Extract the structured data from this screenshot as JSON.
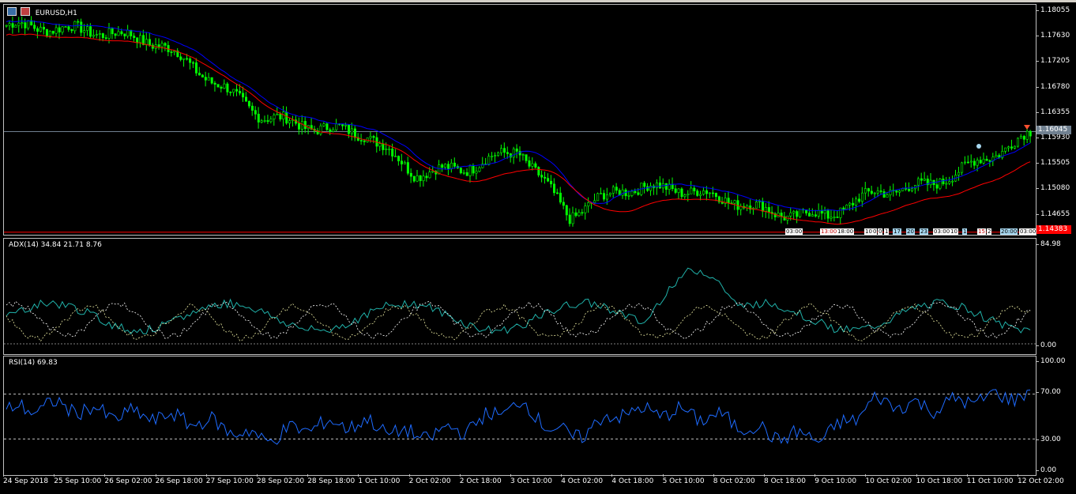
{
  "main": {
    "symbol_label": "EURUSD,H1",
    "price_ticks": [
      "1.18055",
      "1.17630",
      "1.17205",
      "1.16780",
      "1.16355",
      "1.15930",
      "1.15505",
      "1.15080",
      "1.14655"
    ],
    "current_price": "1.16045",
    "stop_level": "1.14383",
    "colors": {
      "candle": "#00ff00",
      "ma_fast": "#0000ff",
      "ma_slow": "#ff0000",
      "grid_line": "#708090",
      "stop_line": "#ff0000"
    },
    "trade_labels": [
      "03:00",
      "13:00",
      "18:00",
      "10",
      "0",
      "0",
      "1",
      "17",
      "20",
      "23",
      "03:00",
      "10",
      "1",
      "15",
      "2",
      "20:00",
      "03:00"
    ]
  },
  "adx": {
    "label": "ADX(14) 34.84 21.71 8.76",
    "max_tick": "84.98",
    "min_tick": "0.00"
  },
  "rsi": {
    "label": "RSI(14) 69.83",
    "ticks": [
      "100.00",
      "70.00",
      "30.00",
      "0.00"
    ],
    "levels": [
      70,
      30
    ],
    "min": 0,
    "max": 100,
    "colors": {
      "line": "#1e6bff"
    }
  },
  "time_axis": {
    "labels": [
      "24 Sep 2018",
      "25 Sep 10:00",
      "26 Sep 02:00",
      "26 Sep 18:00",
      "27 Sep 10:00",
      "28 Sep 02:00",
      "28 Sep 18:00",
      "1 Oct 10:00",
      "2 Oct 02:00",
      "2 Oct 18:00",
      "3 Oct 10:00",
      "4 Oct 02:00",
      "4 Oct 18:00",
      "5 Oct 10:00",
      "8 Oct 02:00",
      "8 Oct 18:00",
      "9 Oct 10:00",
      "10 Oct 02:00",
      "10 Oct 18:00",
      "11 Oct 10:00",
      "12 Oct 02:00"
    ]
  },
  "chart_data": {
    "type": "line",
    "x": [
      "24 Sep 2018",
      "25 Sep 10:00",
      "26 Sep 02:00",
      "26 Sep 18:00",
      "27 Sep 10:00",
      "28 Sep 02:00",
      "28 Sep 18:00",
      "1 Oct 10:00",
      "2 Oct 02:00",
      "2 Oct 18:00",
      "3 Oct 10:00",
      "4 Oct 02:00",
      "4 Oct 18:00",
      "5 Oct 10:00",
      "8 Oct 02:00",
      "8 Oct 18:00",
      "9 Oct 10:00",
      "10 Oct 02:00",
      "10 Oct 18:00",
      "11 Oct 10:00",
      "12 Oct 02:00"
    ],
    "series": [
      {
        "name": "EURUSD,H1",
        "values": [
          1.178,
          1.1775,
          1.1768,
          1.175,
          1.169,
          1.163,
          1.1612,
          1.1602,
          1.1535,
          1.1545,
          1.1575,
          1.1465,
          1.151,
          1.1512,
          1.1495,
          1.147,
          1.1465,
          1.1505,
          1.1515,
          1.1555,
          1.16
        ]
      },
      {
        "name": "RSI(14) 69.83",
        "values": [
          55,
          60,
          52,
          50,
          44,
          30,
          42,
          44,
          32,
          40,
          62,
          30,
          54,
          54,
          48,
          33,
          32,
          64,
          58,
          66,
          70
        ]
      }
    ],
    "ylim": [
      1.1438,
      1.181
    ]
  }
}
